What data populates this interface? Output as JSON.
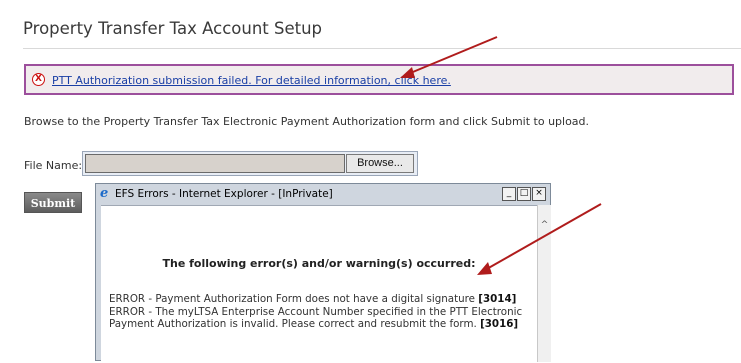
{
  "page": {
    "title": "Property Transfer Tax Account Setup"
  },
  "error_banner": {
    "icon": "error-circle-x-icon",
    "icon_glyph": "X",
    "link_text": "PTT Authorization submission failed. For detailed information, click here."
  },
  "instructions": "Browse to the Property Transfer Tax Electronic Payment Authorization form and click Submit to upload.",
  "upload": {
    "file_label": "File Name:",
    "file_value": "",
    "browse_label": "Browse...",
    "submit_label": "Submit"
  },
  "popup": {
    "title": "EFS Errors - Internet Explorer - [InPrivate]",
    "app_icon": "e",
    "window_buttons": [
      "_",
      "□",
      "×"
    ],
    "scroll_up_glyph": "^",
    "heading": "The following error(s) and/or warning(s) occurred:",
    "errors": [
      {
        "text": "ERROR - Payment Authorization Form does not have a digital signature",
        "code": "[3014]"
      },
      {
        "text_lines": [
          "ERROR - The myLTSA Enterprise Account Number specified in the PTT Electronic",
          "Payment Authorization is invalid. Please correct and resubmit the form."
        ],
        "code": "[3016]"
      }
    ]
  },
  "colors": {
    "annotation_arrow": "#b01c1c",
    "banner_border": "#9c4f9c",
    "link": "#1a3fa5"
  }
}
